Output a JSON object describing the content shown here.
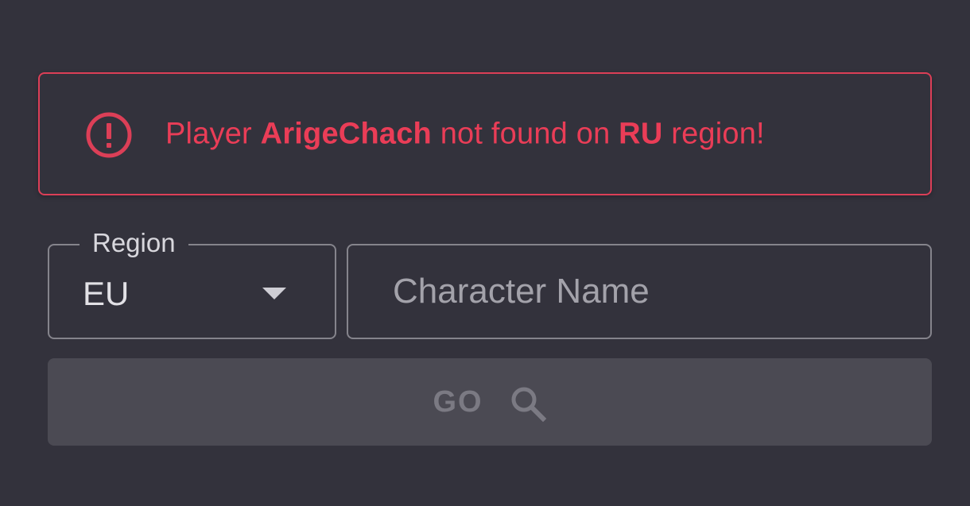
{
  "alert": {
    "icon": "alert-circle-icon",
    "prefix": "Player ",
    "player": "ArigeChach",
    "middle": " not found on ",
    "region": "RU",
    "suffix": " region!",
    "color": "#ea3d57"
  },
  "form": {
    "region_label": "Region",
    "region_value": "EU",
    "region_arrow_icon": "dropdown-arrow-icon",
    "name_placeholder": "Character Name",
    "name_value": ""
  },
  "go_button": {
    "label": "GO",
    "icon": "search-icon"
  },
  "colors": {
    "background": "#33323c",
    "error": "#dc3f57",
    "button_bg": "#4b4a53",
    "border": "#85848c"
  }
}
